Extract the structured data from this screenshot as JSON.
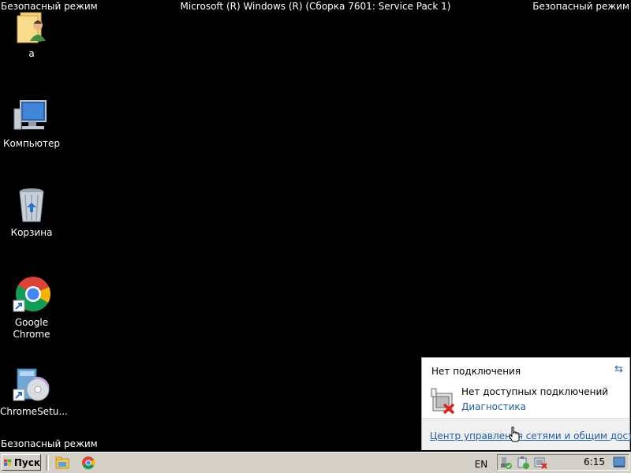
{
  "safe_mode_label": "Безопасный режим",
  "os_title": "Microsoft (R) Windows (R) (Сборка 7601: Service Pack 1)",
  "desktop": {
    "icons": [
      {
        "label": "a",
        "icon": "user-folder-icon"
      },
      {
        "label": "Компьютер",
        "icon": "computer-icon"
      },
      {
        "label": "Корзина",
        "icon": "recycle-bin-icon"
      },
      {
        "label": "Google Chrome",
        "icon": "chrome-icon"
      },
      {
        "label": "ChromeSetu...",
        "icon": "installer-icon"
      }
    ]
  },
  "taskbar": {
    "start_label": "Пуск",
    "language": "EN",
    "clock": "6:15"
  },
  "network_popup": {
    "title": "Нет подключения",
    "status": "Нет доступных подключений",
    "diagnostics_link": "Диагностика",
    "footer_link": "Центр управления сетями и общим доступо"
  }
}
